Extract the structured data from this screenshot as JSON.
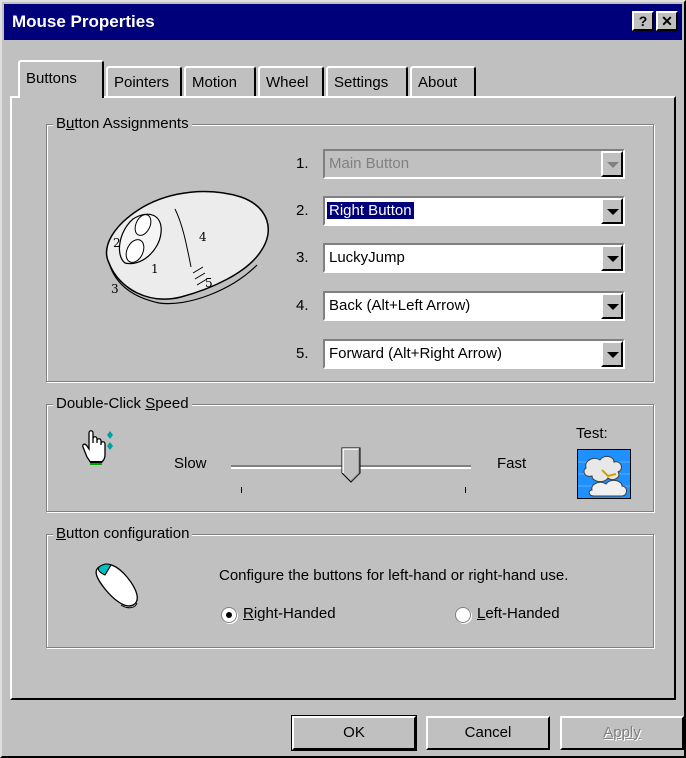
{
  "window": {
    "title": "Mouse Properties",
    "help_label": "?",
    "close_label": "✕"
  },
  "tabs": [
    {
      "label": "Buttons",
      "active": true
    },
    {
      "label": "Pointers"
    },
    {
      "label": "Motion"
    },
    {
      "label": "Wheel"
    },
    {
      "label": "Settings"
    },
    {
      "label": "About"
    }
  ],
  "assignments": {
    "group_label": "Button Assignments",
    "mouse_labels": [
      "1",
      "2",
      "3",
      "4",
      "5"
    ],
    "rows": [
      {
        "num": "1.",
        "value": "Main Button",
        "state": "disabled"
      },
      {
        "num": "2.",
        "value": "Right Button",
        "state": "selected"
      },
      {
        "num": "3.",
        "value": "LuckyJump",
        "state": "normal"
      },
      {
        "num": "4.",
        "value": "Back (Alt+Left Arrow)",
        "state": "normal"
      },
      {
        "num": "5.",
        "value": "Forward (Alt+Right Arrow)",
        "state": "normal"
      }
    ]
  },
  "double_click": {
    "group_label": "Double-Click Speed",
    "slow_label": "Slow",
    "fast_label": "Fast",
    "test_label": "Test:",
    "slider_value_fraction": 0.5
  },
  "configuration": {
    "group_label": "Button configuration",
    "description": "Configure the buttons for left-hand or right-hand use.",
    "right_label": "Right-Handed",
    "left_label": "Left-Handed",
    "selected": "right"
  },
  "buttons": {
    "ok": "OK",
    "cancel": "Cancel",
    "apply": "Apply"
  },
  "colors": {
    "title_bar": "#00007b",
    "face": "#c0c0c0",
    "selection": "#00007b"
  }
}
